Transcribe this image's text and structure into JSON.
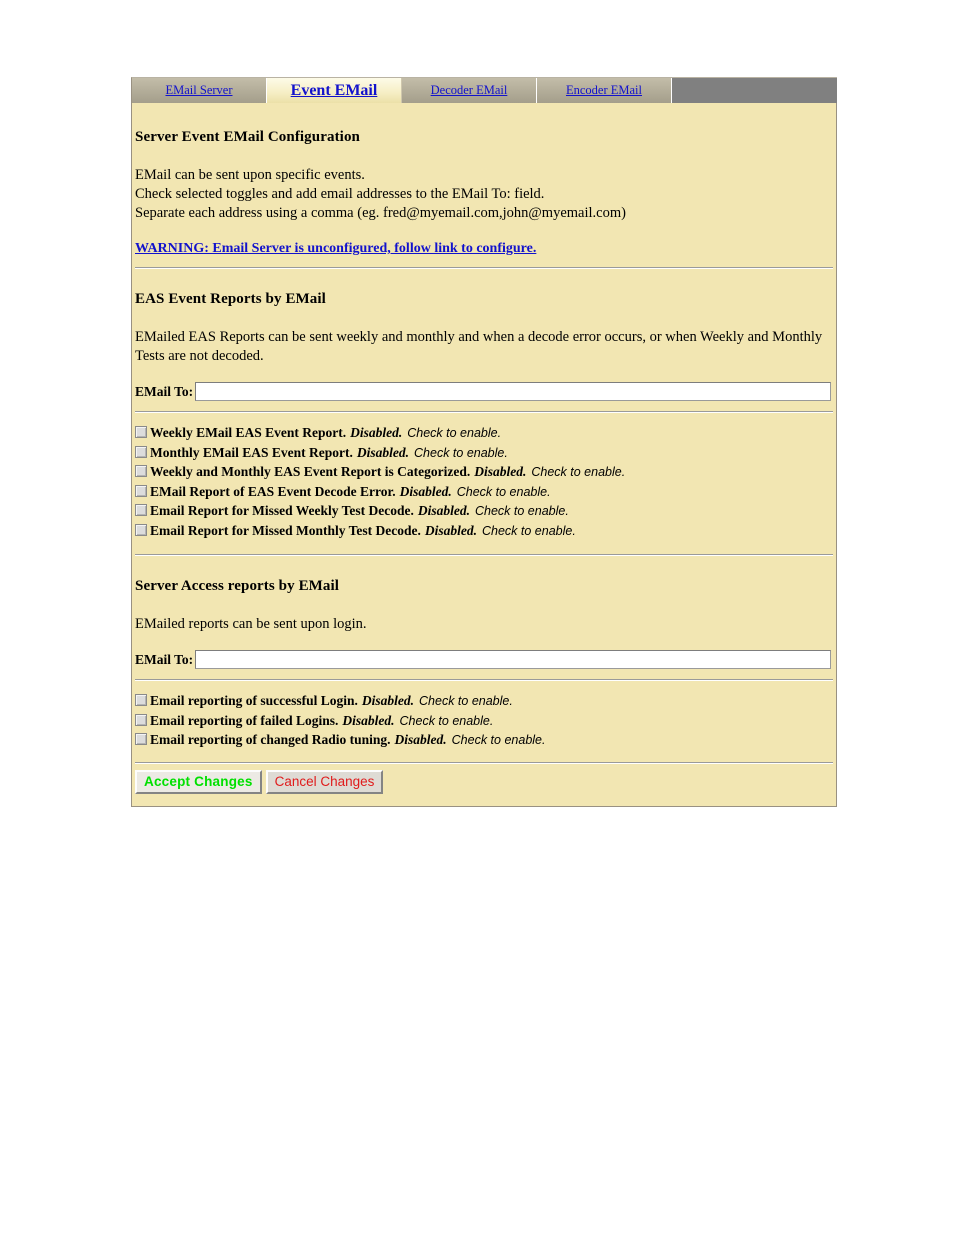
{
  "tabs": [
    {
      "label": "EMail Server",
      "active": false
    },
    {
      "label": "Event EMail",
      "active": true
    },
    {
      "label": "Decoder EMail",
      "active": false
    },
    {
      "label": "Encoder EMail",
      "active": false
    }
  ],
  "main": {
    "title": "Server Event EMail Configuration",
    "intro_lines": [
      "EMail can be sent upon specific events.",
      "Check selected toggles and add email addresses to the EMail To: field.",
      "Separate each address using a comma (eg. fred@myemail.com,john@myemail.com)"
    ],
    "warning": "WARNING: Email Server is unconfigured, follow link to configure."
  },
  "eas_section": {
    "title": "EAS Event Reports by EMail",
    "description": "EMailed EAS Reports can be sent weekly and monthly and when a decode error occurs, or when Weekly and Monthly Tests are not decoded.",
    "email_to_label": "EMail To:",
    "email_to_value": "",
    "email_to_placeholder": "",
    "checkboxes": [
      {
        "label": "Weekly EMail EAS Event Report.",
        "state": "Disabled.",
        "hint": "Check to enable.",
        "checked": false
      },
      {
        "label": "Monthly EMail EAS Event Report.",
        "state": "Disabled.",
        "hint": "Check to enable.",
        "checked": false
      },
      {
        "label": "Weekly and Monthly EAS Event Report is Categorized.",
        "state": "Disabled.",
        "hint": "Check to enable.",
        "checked": false
      },
      {
        "label": "EMail Report of EAS Event Decode Error.",
        "state": "Disabled.",
        "hint": "Check to enable.",
        "checked": false
      },
      {
        "label": "Email Report for Missed Weekly Test Decode.",
        "state": "Disabled.",
        "hint": "Check to enable.",
        "checked": false
      },
      {
        "label": "Email Report for Missed Monthly Test Decode.",
        "state": "Disabled.",
        "hint": "Check to enable.",
        "checked": false
      }
    ]
  },
  "access_section": {
    "title": "Server Access reports by EMail",
    "description": "EMailed reports can be sent upon login.",
    "email_to_label": "EMail To:",
    "email_to_value": "",
    "email_to_placeholder": "",
    "checkboxes": [
      {
        "label": "Email reporting of successful Login.",
        "state": "Disabled.",
        "hint": "Check to enable.",
        "checked": false
      },
      {
        "label": "Email reporting of failed Logins.",
        "state": "Disabled.",
        "hint": "Check to enable.",
        "checked": false
      },
      {
        "label": "Email reporting of changed Radio tuning.",
        "state": "Disabled.",
        "hint": "Check to enable.",
        "checked": false
      }
    ]
  },
  "buttons": {
    "accept_label": "Accept Changes",
    "cancel_label": "Cancel Changes"
  },
  "colors": {
    "panel_bg": "#f2e6b2",
    "tabbar_bg": "#808080",
    "link": "#1212cc",
    "accept": "#00e000",
    "cancel": "#e01b1b"
  }
}
